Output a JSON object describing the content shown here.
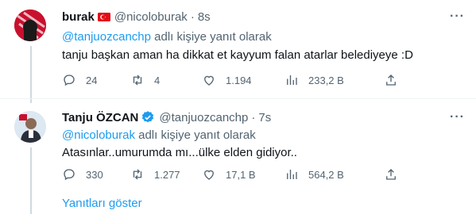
{
  "tweet1": {
    "name": "burak",
    "handle": "@nicoloburak",
    "separator": "·",
    "time": "8s",
    "reply_link": "@tanjuozcanchp",
    "reply_suffix": " adlı kişiye yanıt olarak",
    "text": "tanju başkan aman ha dikkat et kayyum falan atarlar belediyeye :D",
    "more": "···",
    "stats": {
      "replies": "24",
      "retweets": "4",
      "likes": "1.194",
      "views": "233,2 B"
    }
  },
  "tweet2": {
    "name": "Tanju ÖZCAN",
    "handle": "@tanjuozcanchp",
    "separator": "·",
    "time": "7s",
    "reply_link": "@nicoloburak",
    "reply_suffix": " adlı kişiye yanıt olarak",
    "text": "Atasınlar..umurumda mı...ülke elden gidiyor..",
    "more": "···",
    "stats": {
      "replies": "330",
      "retweets": "1.277",
      "likes": "17,1 B",
      "views": "564,2 B"
    }
  },
  "show_replies": "Yanıtları göster",
  "colors": {
    "accent": "#1d9bf0",
    "muted": "#536471",
    "text": "#0f1419",
    "flag_red": "#e30a17"
  },
  "icons": [
    "flag-turkey-icon",
    "verified-badge-icon",
    "reply-icon",
    "retweet-icon",
    "like-icon",
    "views-icon",
    "share-icon",
    "more-icon"
  ]
}
